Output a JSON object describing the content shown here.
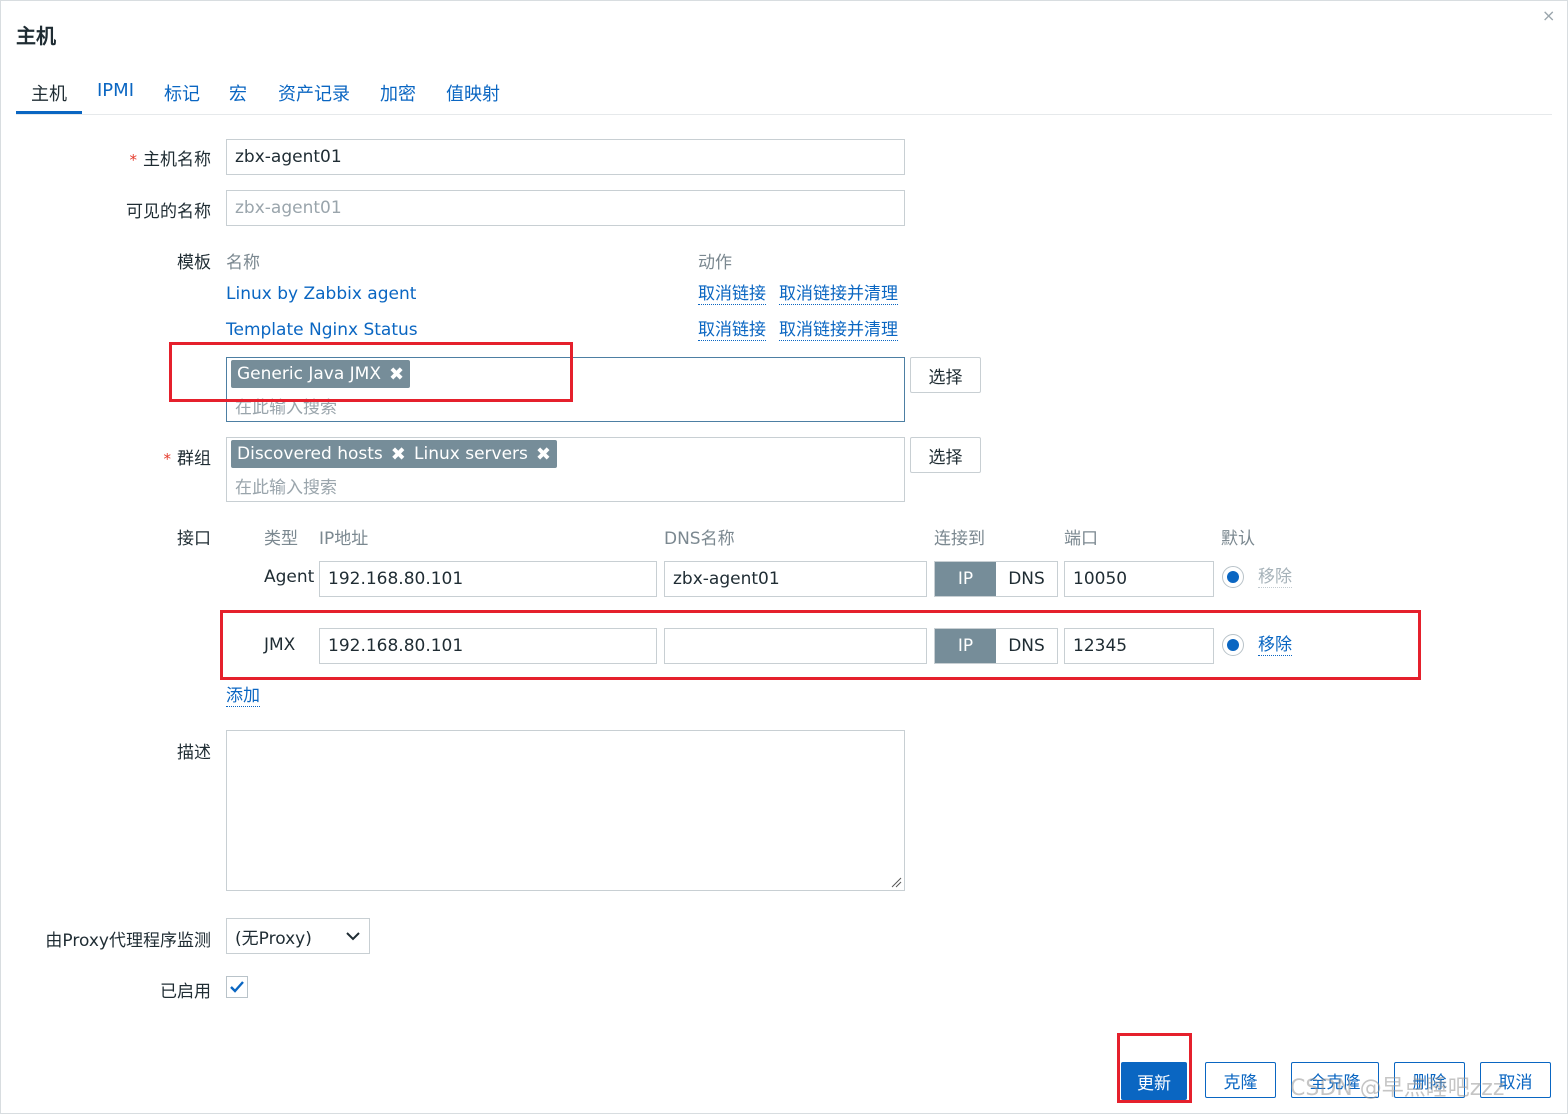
{
  "dialog": {
    "title": "主机",
    "close_glyph": "×"
  },
  "tabs": [
    "主机",
    "IPMI",
    "标记",
    "宏",
    "资产记录",
    "加密",
    "值映射"
  ],
  "form": {
    "host_name_label": "主机名称",
    "host_name_value": "zbx-agent01",
    "visible_name_label": "可见的名称",
    "visible_name_placeholder": "zbx-agent01",
    "templates_label": "模板",
    "templates_col_name": "名称",
    "templates_col_action": "动作",
    "templates": [
      {
        "name": "Linux by Zabbix agent",
        "unlink": "取消链接",
        "unlink_clear": "取消链接并清理"
      },
      {
        "name": "Template Nginx Status",
        "unlink": "取消链接",
        "unlink_clear": "取消链接并清理"
      }
    ],
    "new_template_chip": "Generic Java JMX",
    "search_placeholder": "在此输入搜索",
    "select_label": "选择",
    "groups_label": "群组",
    "groups": [
      "Discovered hosts",
      "Linux servers"
    ],
    "interfaces_label": "接口",
    "interface_headers": {
      "type": "类型",
      "ip": "IP地址",
      "dns": "DNS名称",
      "connect": "连接到",
      "port": "端口",
      "default": "默认"
    },
    "interfaces": [
      {
        "type": "Agent",
        "ip": "192.168.80.101",
        "dns": "zbx-agent01",
        "ip_btn": "IP",
        "dns_btn": "DNS",
        "port": "10050",
        "remove": "移除"
      },
      {
        "type": "JMX",
        "ip": "192.168.80.101",
        "dns": "",
        "ip_btn": "IP",
        "dns_btn": "DNS",
        "port": "12345",
        "remove": "移除"
      }
    ],
    "add_label": "添加",
    "description_label": "描述",
    "proxy_label": "由Proxy代理程序监测",
    "proxy_value": "(无Proxy)",
    "enabled_label": "已启用"
  },
  "footer": {
    "update": "更新",
    "clone": "克隆",
    "full_clone": "全克隆",
    "delete": "删除",
    "cancel": "取消"
  },
  "watermark": "CSDN @早点睡吧zzz",
  "colors": {
    "accent": "#0a66c2",
    "chip": "#768d99",
    "highlight": "#e5202c"
  }
}
